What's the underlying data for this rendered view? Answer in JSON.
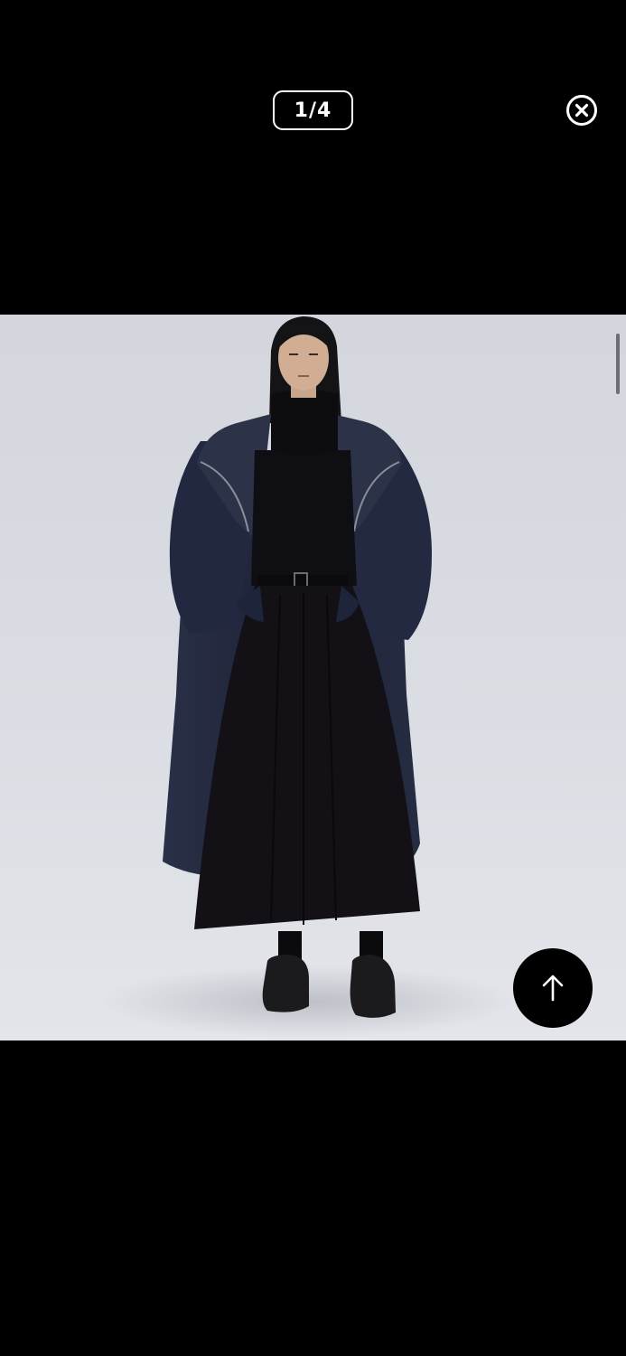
{
  "viewer": {
    "counter": "1/4",
    "current_index": 1,
    "total_images": 4
  },
  "icons": {
    "close": "close-circle-icon",
    "back_to_top": "arrow-up-icon"
  },
  "colors": {
    "background": "#000000",
    "overlay_text": "#ffffff",
    "photo_backdrop": "#d8dbe1",
    "coat": "#1b2033",
    "skirt": "#121014"
  },
  "scroll": {
    "position_fraction": 0.0
  }
}
